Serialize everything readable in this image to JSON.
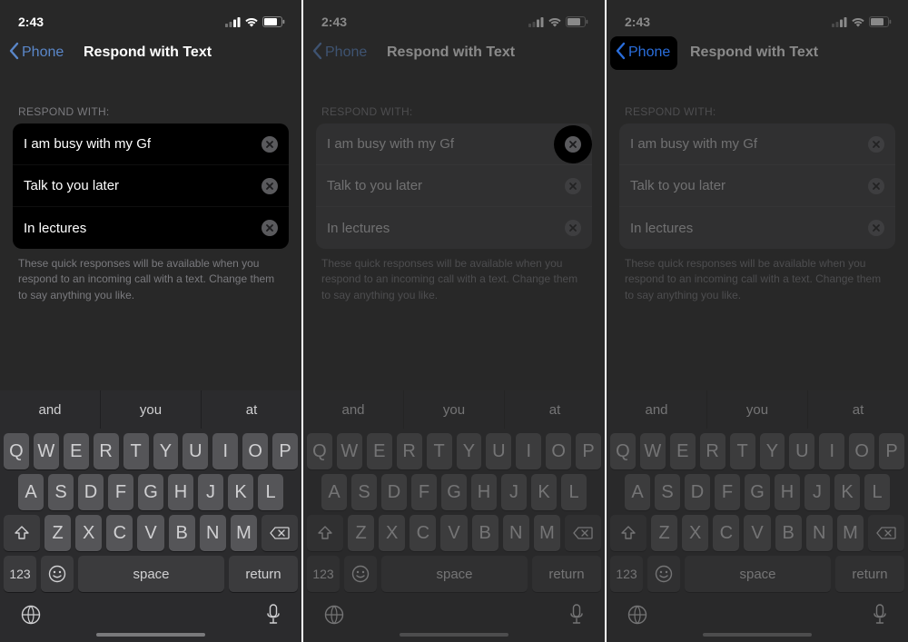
{
  "status": {
    "time": "2:43"
  },
  "nav": {
    "back_label": "Phone",
    "title": "Respond with Text"
  },
  "section": {
    "header": "RESPOND WITH:"
  },
  "responses": [
    {
      "text": "I am busy with my Gf"
    },
    {
      "text": "Talk to you later"
    },
    {
      "text": "In lectures"
    }
  ],
  "footer": "These quick responses will be available when you respond to an incoming call with a text. Change them to say anything you like.",
  "predict": [
    "and",
    "you",
    "at"
  ],
  "keys": {
    "r1": [
      "Q",
      "W",
      "E",
      "R",
      "T",
      "Y",
      "U",
      "I",
      "O",
      "P"
    ],
    "r2": [
      "A",
      "S",
      "D",
      "F",
      "G",
      "H",
      "J",
      "K",
      "L"
    ],
    "r3": [
      "Z",
      "X",
      "C",
      "V",
      "B",
      "N",
      "M"
    ],
    "k123": "123",
    "space": "space",
    "ret": "return"
  }
}
